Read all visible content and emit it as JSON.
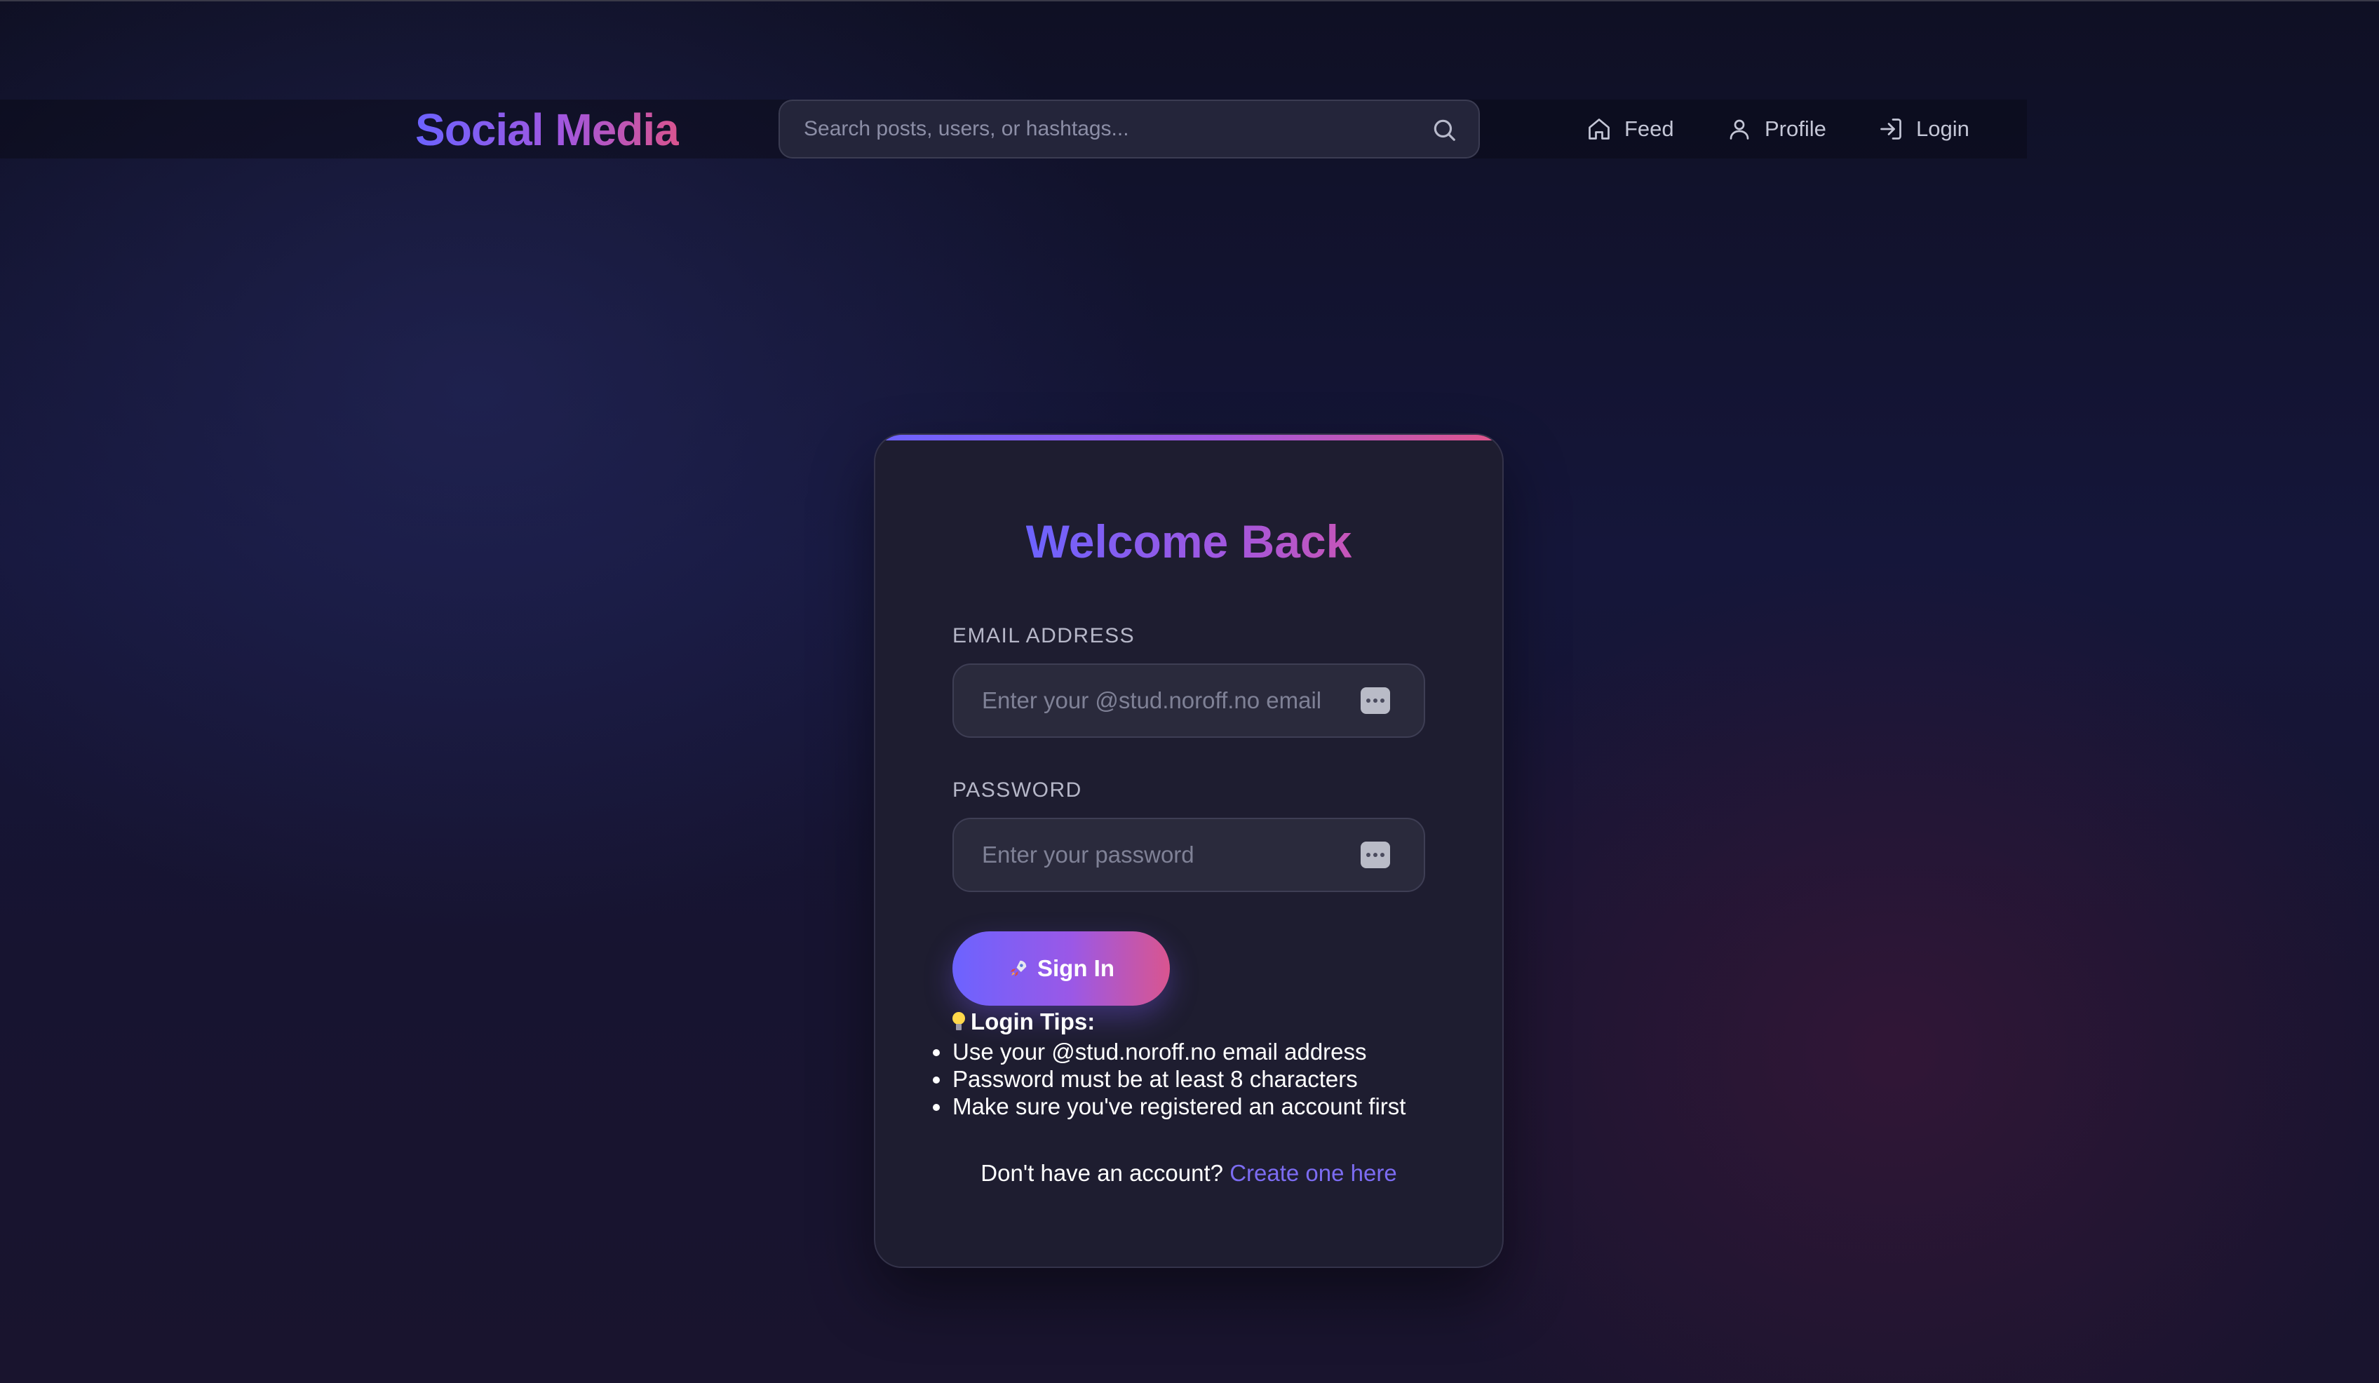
{
  "header": {
    "logo": "Social Media",
    "search_placeholder": "Search posts, users, or hashtags...",
    "nav": [
      {
        "label": "Feed",
        "icon": "home-icon"
      },
      {
        "label": "Profile",
        "icon": "user-icon"
      },
      {
        "label": "Login",
        "icon": "login-icon"
      }
    ]
  },
  "login": {
    "title": "Welcome Back",
    "email_label": "EMAIL ADDRESS",
    "email_placeholder": "Enter your @stud.noroff.no email",
    "password_label": "PASSWORD",
    "password_placeholder": "Enter your password",
    "submit_label": "Sign In",
    "tips_title": "Login Tips:",
    "tips": [
      "Use your @stud.noroff.no email address",
      "Password must be at least 8 characters",
      "Make sure you've registered an account first"
    ],
    "signup_prompt": "Don't have an account?",
    "signup_link": "Create one here"
  },
  "colors": {
    "accent_start": "#6c63ff",
    "accent_mid": "#a057e0",
    "accent_end": "#d9548f",
    "link": "#7c6cf2"
  }
}
